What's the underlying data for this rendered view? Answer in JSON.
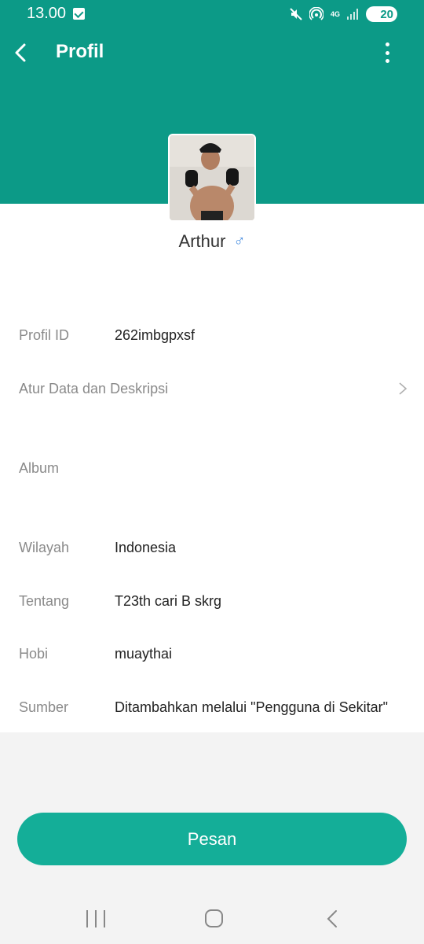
{
  "status_bar": {
    "time": "13.00",
    "network": "4G",
    "battery": "20"
  },
  "header": {
    "title": "Profil"
  },
  "profile": {
    "name": "Arthur"
  },
  "rows": {
    "profile_id": {
      "label": "Profil ID",
      "value": "262imbgpxsf"
    },
    "atur_data": {
      "label": "Atur Data dan Deskripsi"
    },
    "album": {
      "label": "Album"
    },
    "wilayah": {
      "label": "Wilayah",
      "value": "Indonesia"
    },
    "tentang": {
      "label": "Tentang",
      "value": "T23th cari B skrg"
    },
    "hobi": {
      "label": "Hobi",
      "value": "muaythai"
    },
    "sumber": {
      "label": "Sumber",
      "value": "Ditambahkan melalui \"Pengguna di Sekitar\""
    }
  },
  "actions": {
    "message_label": "Pesan"
  },
  "colors": {
    "header_bg": "#0c9a87",
    "button_bg": "#14ae98",
    "gender_icon": "#4a8fe0"
  }
}
